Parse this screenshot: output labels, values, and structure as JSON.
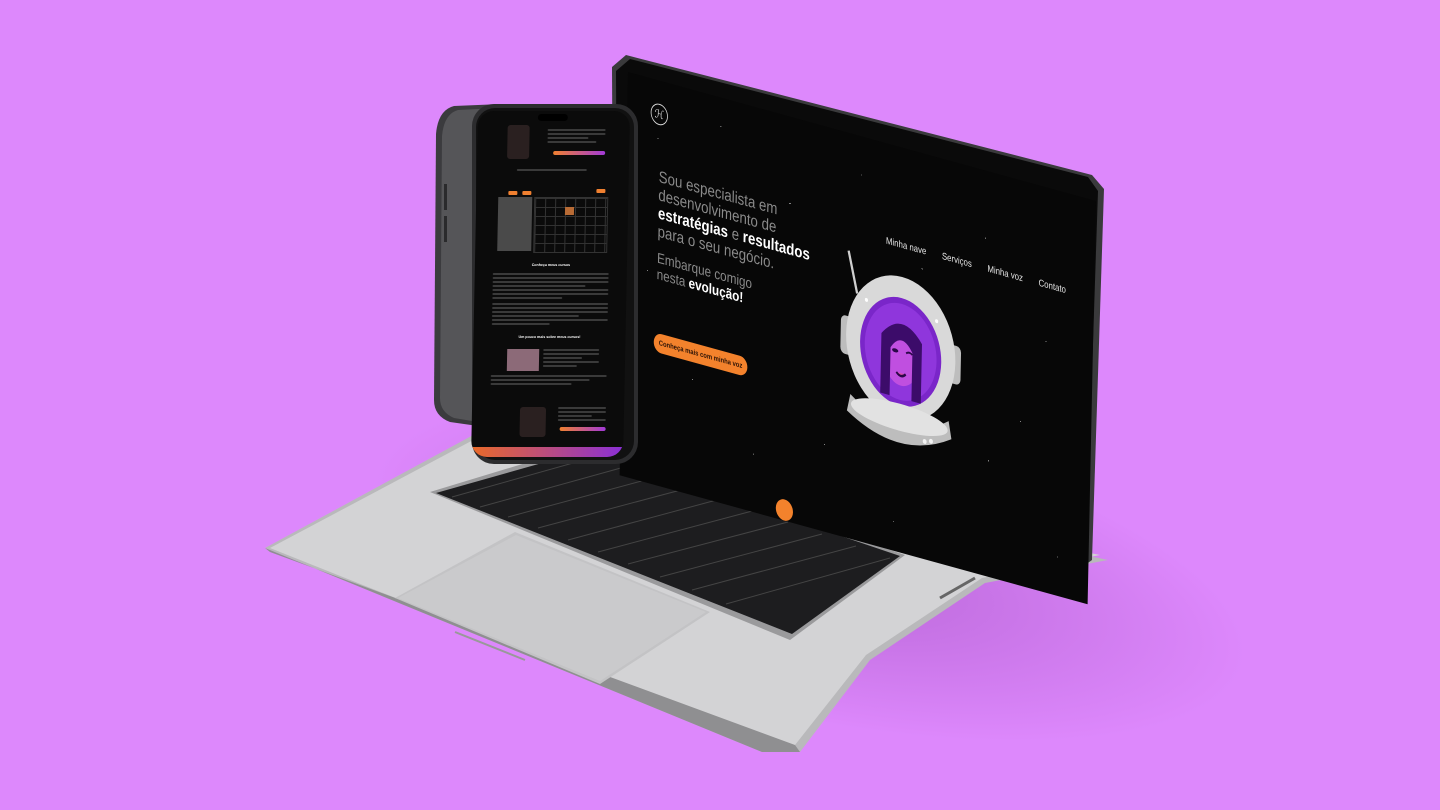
{
  "page": {
    "background": "#dd88fc",
    "device_scene": "laptop-and-phone-mockup"
  },
  "site": {
    "nav": [
      "Minha nave",
      "Serviços",
      "Minha voz",
      "Contato"
    ],
    "hero": {
      "line1": "Sou especialista em",
      "line2": "desenvolvimento de",
      "line3_bold_a": "estratégias",
      "line3_mid": " e ",
      "line3_bold_b": "resultados",
      "line4": "para o seu negócio.",
      "sub1": "Embarque comigo",
      "sub2_pre": "nesta ",
      "sub2_bold": "evolução!",
      "cta": "Conheça mais com minha voz"
    },
    "colors": {
      "accent_orange": "#f3822c",
      "accent_purple": "#8a2fd6",
      "screen_bg": "#070707"
    }
  },
  "phone": {
    "sections": [
      "Conheça meus cursos",
      "Um pouco mais sobre meus cursos!"
    ]
  }
}
